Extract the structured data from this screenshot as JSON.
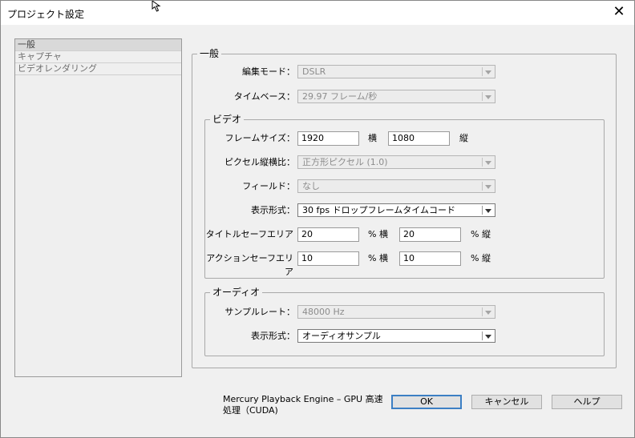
{
  "window": {
    "title": "プロジェクト設定",
    "close_glyph": "✕"
  },
  "sidebar": {
    "items": [
      {
        "label": "一般"
      },
      {
        "label": "キャプチャ"
      },
      {
        "label": "ビデオレンダリング"
      }
    ]
  },
  "general": {
    "legend": "一般",
    "edit_mode": {
      "label": "編集モード：",
      "value": "DSLR"
    },
    "timebase": {
      "label": "タイムベース：",
      "value": "29.97 フレーム/秒"
    }
  },
  "video": {
    "legend": "ビデオ",
    "frame_size": {
      "label": "フレームサイズ：",
      "width": "1920",
      "width_unit": "横",
      "height": "1080",
      "height_unit": "縦"
    },
    "pixel_aspect": {
      "label": "ピクセル縦横比：",
      "value": "正方形ピクセル (1.0)"
    },
    "fields": {
      "label": "フィールド：",
      "value": "なし"
    },
    "display_format": {
      "label": "表示形式：",
      "value": "30 fps ドロップフレームタイムコード"
    },
    "title_safe": {
      "label": "タイトルセーフエリア",
      "h": "20",
      "h_unit": "% 横",
      "v": "20",
      "v_unit": "% 縦"
    },
    "action_safe": {
      "label": "アクションセーフエリア",
      "h": "10",
      "h_unit": "% 横",
      "v": "10",
      "v_unit": "% 縦"
    }
  },
  "audio": {
    "legend": "オーディオ",
    "sample_rate": {
      "label": "サンプルレート：",
      "value": "48000 Hz"
    },
    "display_format": {
      "label": "表示形式：",
      "value": "オーディオサンプル"
    }
  },
  "footer": {
    "engine_line1": "Mercury Playback Engine – GPU 高速",
    "engine_line2": "処理（CUDA)",
    "ok": "OK",
    "cancel": "キャンセル",
    "help": "ヘルプ"
  }
}
